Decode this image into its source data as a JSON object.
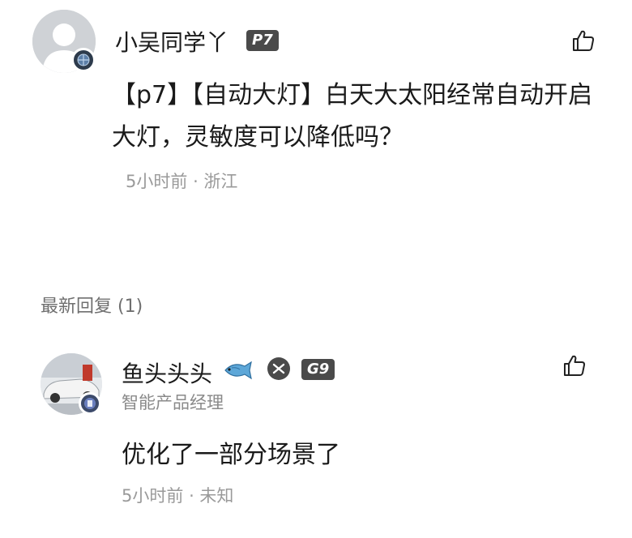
{
  "post": {
    "username": "小吴同学丫",
    "model_tag": "P7",
    "content": "【p7】【自动大灯】白天大太阳经常自动开启大灯，灵敏度可以降低吗？",
    "time": "5小时前",
    "location": "浙江",
    "avatar_icon": "default-avatar-icon",
    "badge_icon": "globe-badge-icon",
    "like_icon": "thumbs-up-icon"
  },
  "replies_header": {
    "label": "最新回复",
    "count": "(1)"
  },
  "reply": {
    "username": "鱼头头头",
    "name_icon": "fish-emoji",
    "brand_icon": "xpeng-logo-icon",
    "model_tag": "G9",
    "title": "智能产品经理",
    "content": "优化了一部分场景了",
    "time": "5小时前",
    "location": "未知",
    "avatar_icon": "car-photo-avatar",
    "like_icon": "thumbs-up-icon"
  },
  "colors": {
    "text_primary": "#1a1a1a",
    "text_secondary": "#9a9a9a",
    "tag_bg": "#4a4a4a",
    "background": "#ffffff"
  }
}
